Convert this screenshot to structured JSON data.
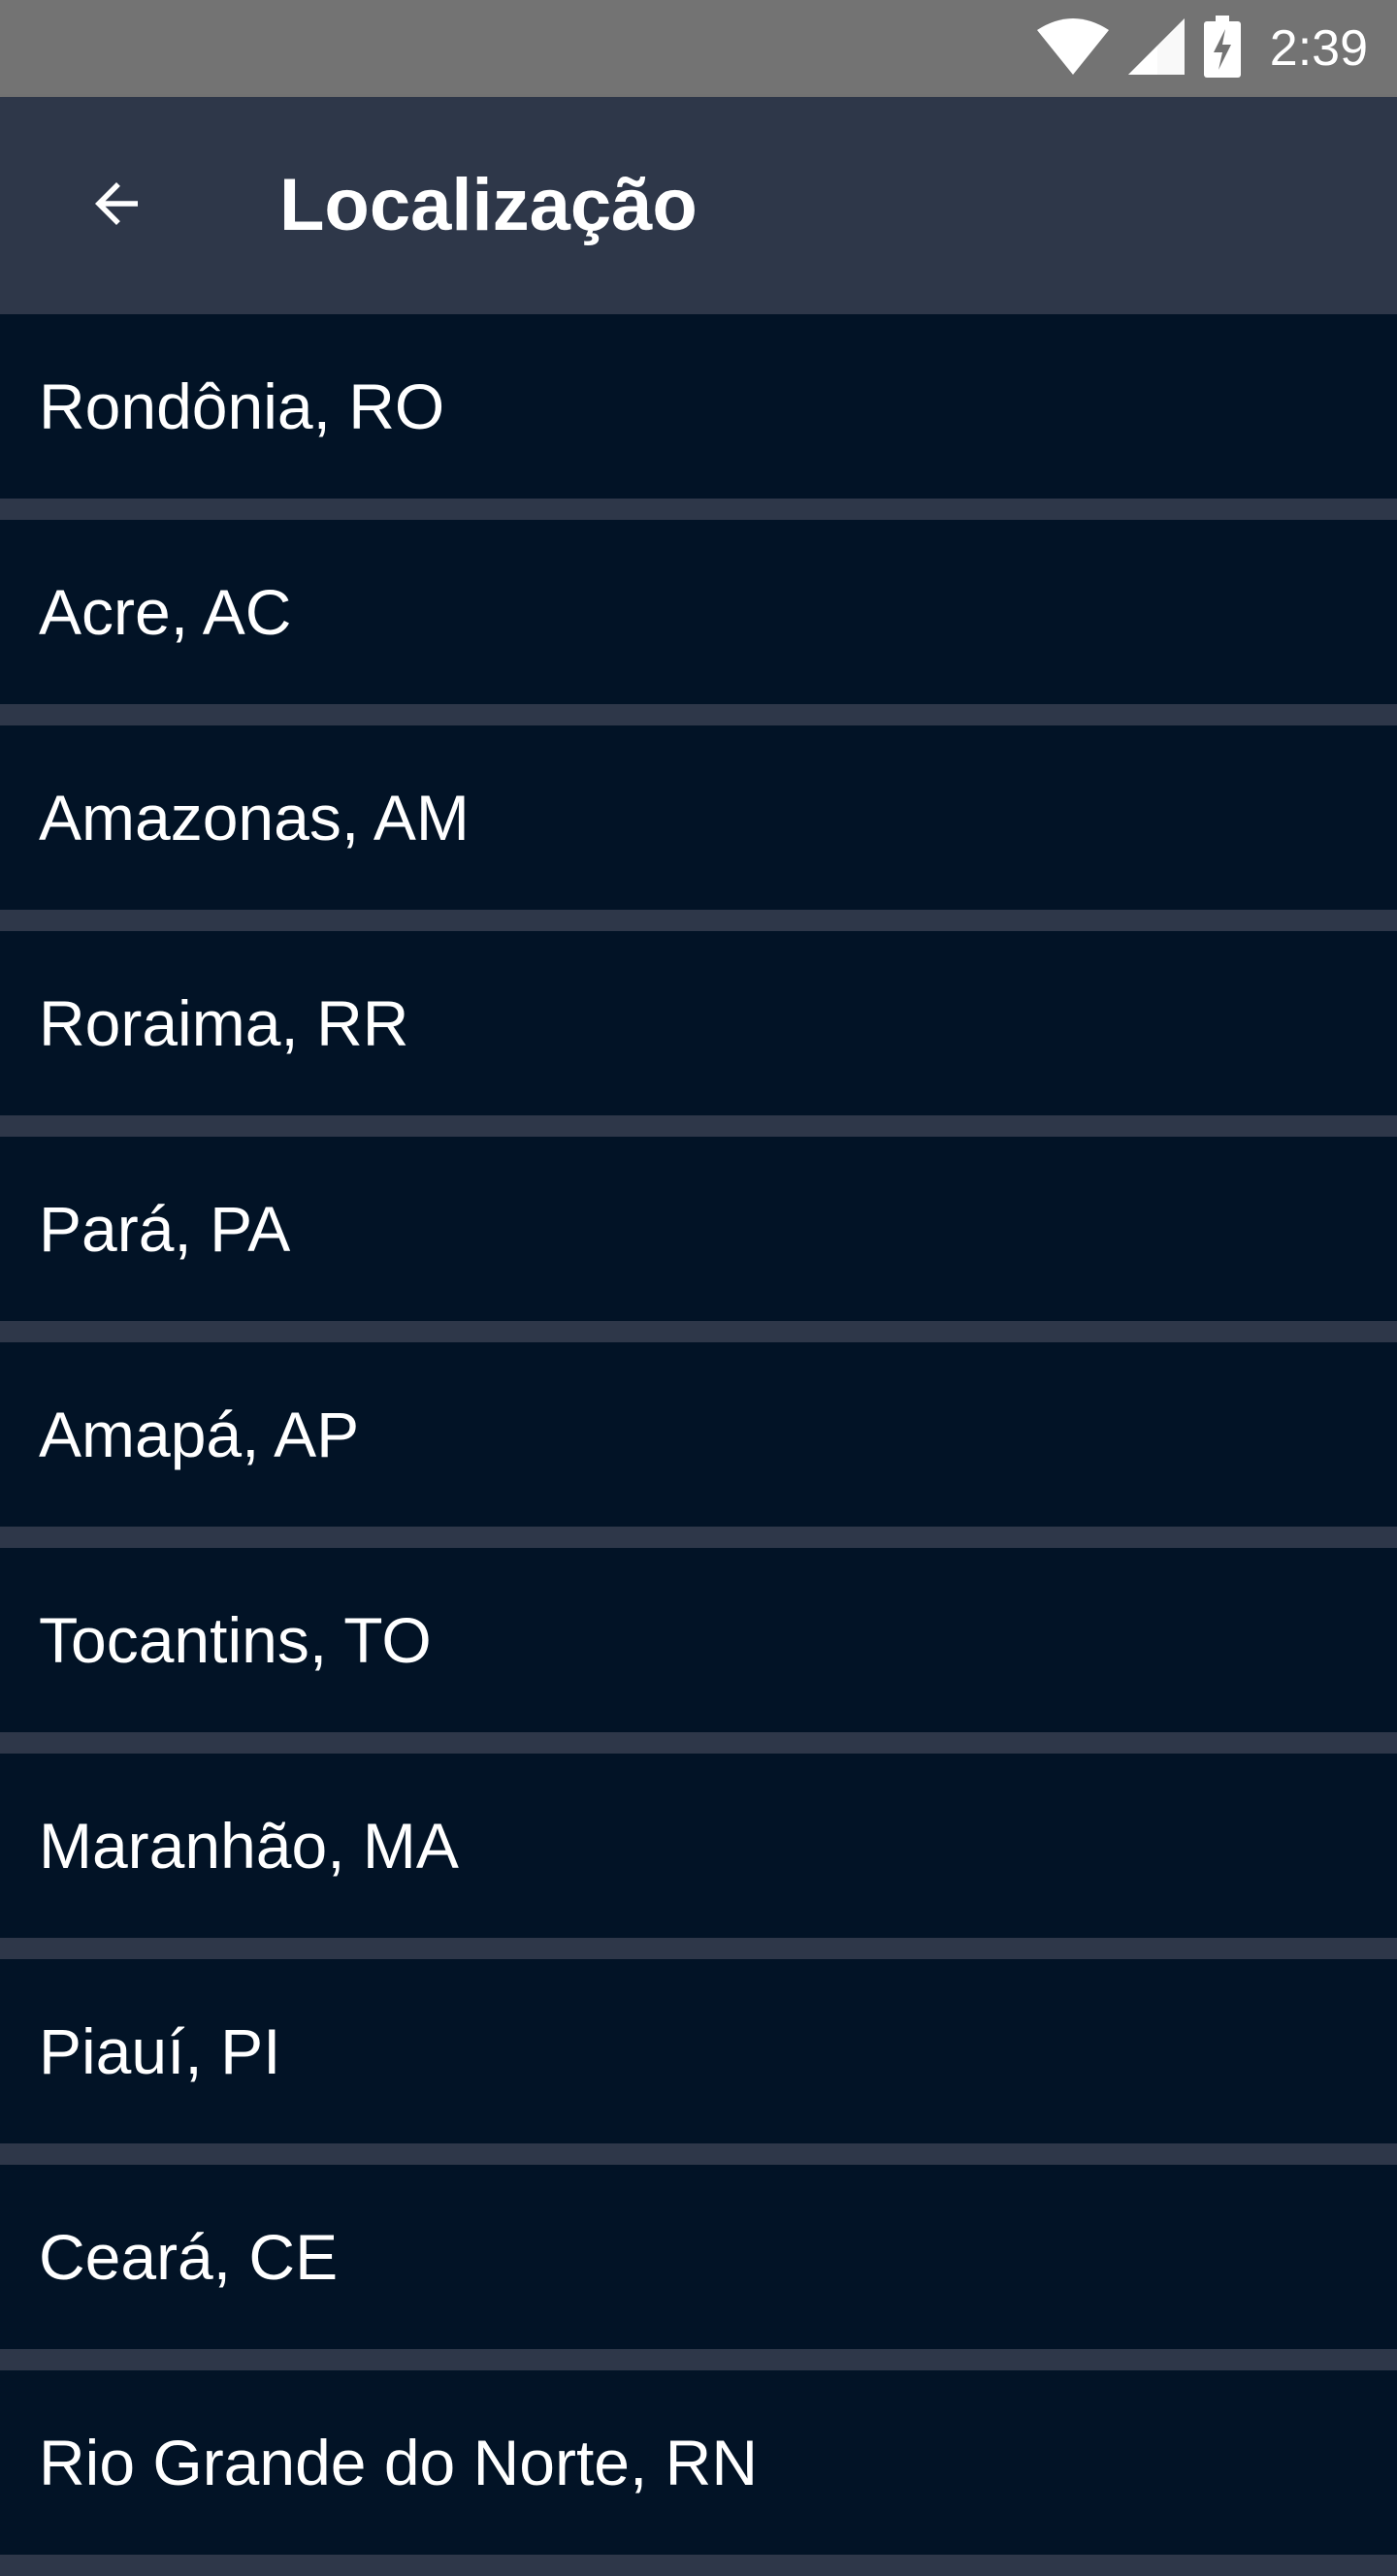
{
  "status_bar": {
    "time": "2:39",
    "icons": [
      "wifi-icon",
      "cell-signal-icon",
      "battery-charging-icon"
    ]
  },
  "app_bar": {
    "title": "Localização",
    "back_icon": "arrow-back-icon"
  },
  "colors": {
    "status_bar": "#737373",
    "app_bar": "#2e3749",
    "list_item": "#021326",
    "divider": "#2e3749",
    "text": "#ffffff"
  },
  "locations": [
    "Rondônia, RO",
    "Acre, AC",
    "Amazonas, AM",
    "Roraima, RR",
    "Pará, PA",
    "Amapá, AP",
    "Tocantins, TO",
    "Maranhão, MA",
    "Piauí, PI",
    "Ceará, CE",
    "Rio Grande do Norte, RN"
  ]
}
